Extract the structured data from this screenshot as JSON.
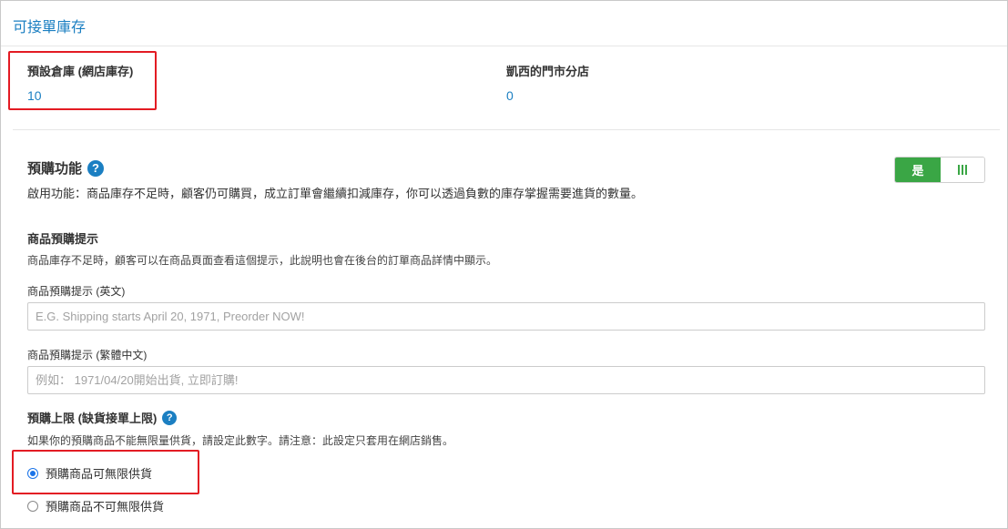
{
  "panel": {
    "title": "可接單庫存"
  },
  "stock": [
    {
      "name": "預設倉庫 (網店庫存)",
      "quantity": "10"
    },
    {
      "name": "凱西的門市分店",
      "quantity": "0"
    }
  ],
  "preorder": {
    "title": "預購功能",
    "help_icon": "?",
    "description": "啟用功能：商品庫存不足時，顧客仍可購買，成立訂單會繼續扣減庫存，你可以透過負數的庫存掌握需要進貨的數量。",
    "toggle": {
      "on_label": "是",
      "state": "on",
      "accent_color": "#3aa645"
    }
  },
  "hint": {
    "title": "商品預購提示",
    "description": "商品庫存不足時，顧客可以在商品頁面查看這個提示，此說明也會在後台的訂單商品詳情中顯示。",
    "fields": [
      {
        "label": "商品預購提示 (英文)",
        "value": "",
        "placeholder": "E.G. Shipping starts April 20, 1971, Preorder NOW!"
      },
      {
        "label": "商品預購提示 (繁體中文)",
        "value": "",
        "placeholder": "例如： 1971/04/20開始出貨, 立即訂購!"
      }
    ]
  },
  "limit": {
    "title": "預購上限 (缺貨接單上限)",
    "help_icon": "?",
    "description": "如果你的預購商品不能無限量供貨，請設定此數字。請注意：此設定只套用在網店銷售。",
    "options": [
      {
        "label": "預購商品可無限供貨",
        "selected": true
      },
      {
        "label": "預購商品不可無限供貨",
        "selected": false
      }
    ]
  },
  "colors": {
    "link": "#1b7fc2",
    "highlight": "#e31b23",
    "radio": "#1a73e8"
  }
}
